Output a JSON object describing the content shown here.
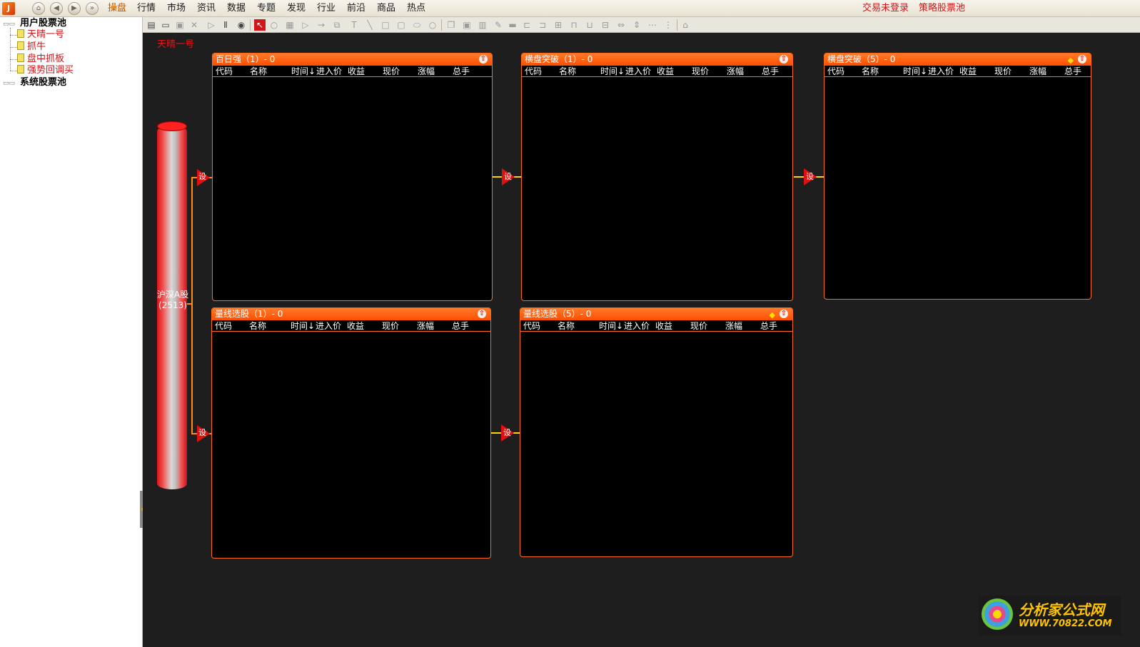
{
  "menubar": {
    "logo_label": "J",
    "nav_icons": [
      "home-icon",
      "back-icon",
      "forward-icon",
      "more-icon"
    ],
    "items": [
      "操盘",
      "行情",
      "市场",
      "资讯",
      "数据",
      "专题",
      "发现",
      "行业",
      "前沿",
      "商品",
      "热点"
    ],
    "active_index": 0,
    "right_links": [
      "交易未登录",
      "策略股票池"
    ]
  },
  "sidebar": {
    "user_pool_label": "用户股票池",
    "user_pools": [
      "天晴一号",
      "抓牛",
      "盘中抓板",
      "强势回调买"
    ],
    "system_pool_label": "系统股票池"
  },
  "toolbar": {
    "icons": [
      "new-icon",
      "open-icon",
      "save-icon",
      "delete-icon",
      "play-icon",
      "pause-icon",
      "stop-icon",
      "pointer-icon",
      "circle-icon",
      "list-icon",
      "triangle-icon",
      "arrow-icon",
      "link-icon",
      "text-icon",
      "line-icon",
      "rect-icon",
      "round-rect-icon",
      "ellipse-icon",
      "circle-shape-icon",
      "copy-icon",
      "paste-icon",
      "clear-icon",
      "format-icon",
      "bar-icon",
      "align-left-icon",
      "align-right-icon",
      "align-center-icon",
      "align-top-icon",
      "align-bottom-icon",
      "align-middle-icon",
      "same-width-icon",
      "same-height-icon",
      "h-space-icon",
      "v-space-icon",
      "tree-icon"
    ]
  },
  "canvas": {
    "strategy_title": "天晴一号",
    "source": {
      "name": "沪深A股",
      "count": "(2513)"
    },
    "gate_label": "设",
    "columns": [
      "代码",
      "名称",
      "时间↓",
      "进入价",
      "收益",
      "现价",
      "涨幅",
      "总手"
    ],
    "panels": [
      {
        "title": "百日强（1）- 0",
        "starred": false
      },
      {
        "title": "横盘突破（1）- 0",
        "starred": false
      },
      {
        "title": "横盘突破（5）- 0",
        "starred": true
      },
      {
        "title": "量线选股（1）- 0",
        "starred": false
      },
      {
        "title": "量线选股（5）- 0",
        "starred": true
      }
    ]
  },
  "watermark": {
    "title": "分析家公式网",
    "url": "WWW.70822.COM"
  },
  "colors": {
    "accent": "#ff5a00",
    "alert_red": "#d0161b",
    "canvas_bg": "#1e1e1e"
  }
}
